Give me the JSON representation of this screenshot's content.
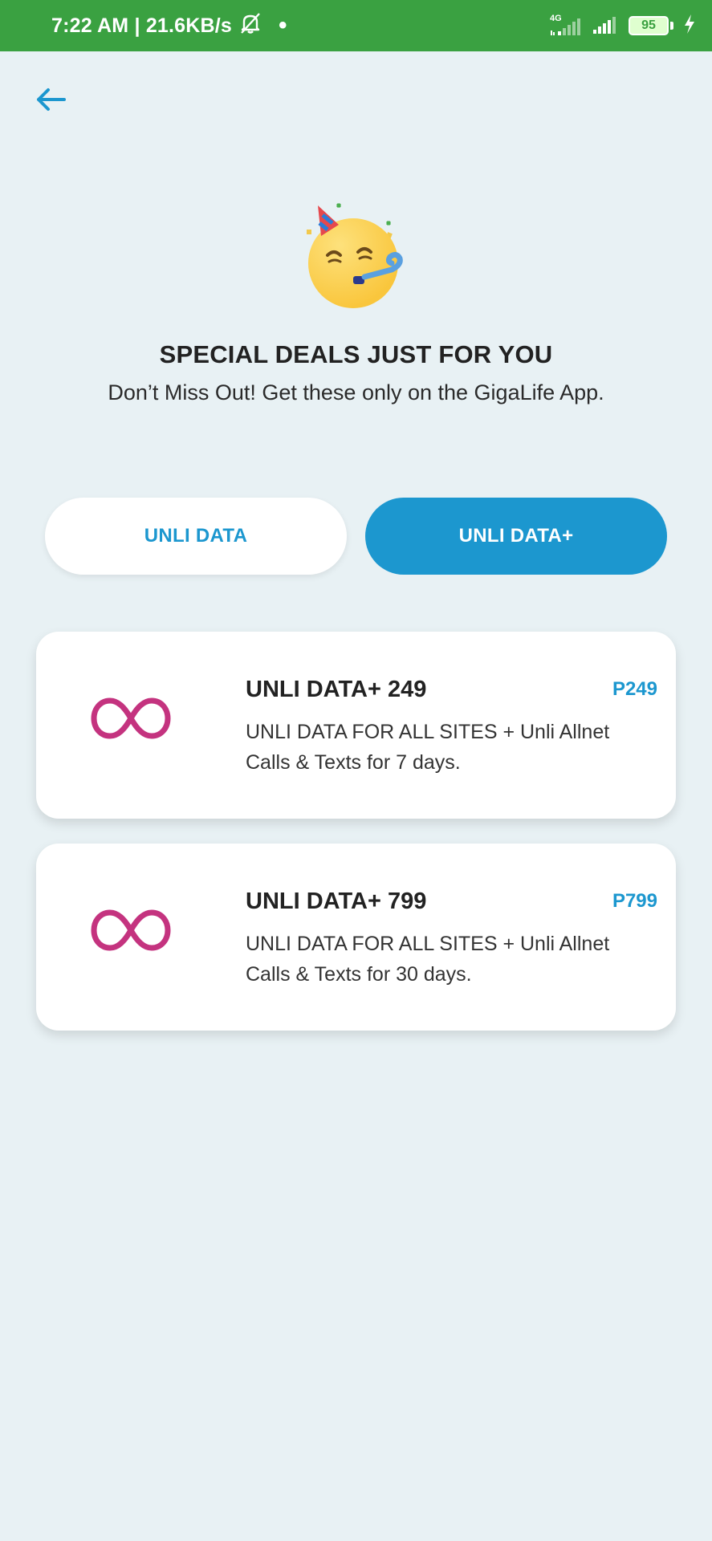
{
  "status_bar": {
    "time_speed": "7:22 AM | 21.6KB/s",
    "network_type": "4G",
    "battery_level": "95"
  },
  "hero": {
    "title": "SPECIAL DEALS JUST FOR YOU",
    "subtitle": "Don’t Miss Out! Get these only on the GigaLife App."
  },
  "tabs": [
    {
      "label": "UNLI DATA",
      "selected": false
    },
    {
      "label": "UNLI DATA+",
      "selected": true
    }
  ],
  "offers": [
    {
      "title": "UNLI DATA+ 249",
      "price": "P249",
      "description": "UNLI DATA FOR ALL SITES + Unli Allnet Calls & Texts for 7 days."
    },
    {
      "title": "UNLI DATA+ 799",
      "price": "P799",
      "description": "UNLI DATA FOR ALL SITES + Unli Allnet Calls & Texts for 30 days."
    }
  ],
  "colors": {
    "status_bar": "#3aa141",
    "accent_blue": "#1c97cf",
    "infinity_magenta": "#c4337f",
    "background": "#e8f1f4"
  },
  "icons": {
    "back": "arrow-left-icon",
    "hero": "party-face-emoji-icon",
    "offer": "infinity-icon"
  }
}
